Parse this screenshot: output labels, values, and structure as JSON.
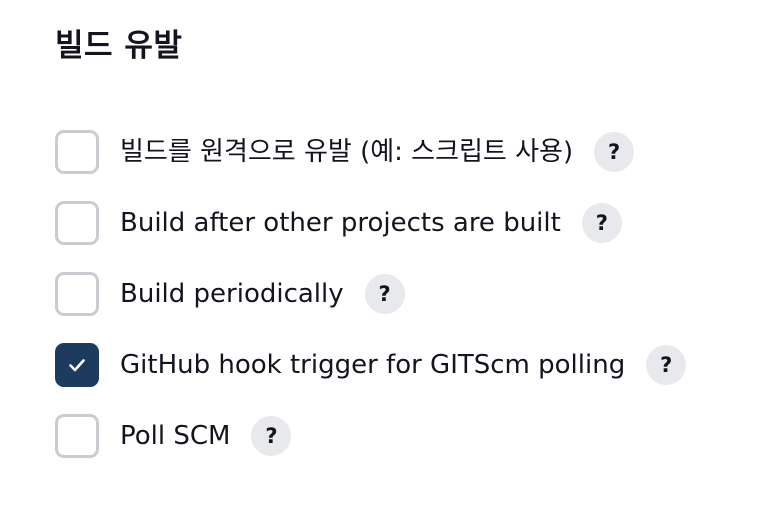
{
  "section": {
    "title": "빌드 유발"
  },
  "options": [
    {
      "label": "빌드를 원격으로 유발 (예: 스크립트 사용)",
      "checked": false,
      "help": "?"
    },
    {
      "label": "Build after other projects are built",
      "checked": false,
      "help": "?"
    },
    {
      "label": "Build periodically",
      "checked": false,
      "help": "?"
    },
    {
      "label": "GitHub hook trigger for GITScm polling",
      "checked": true,
      "help": "?"
    },
    {
      "label": "Poll SCM",
      "checked": false,
      "help": "?"
    }
  ],
  "icons": {
    "checked_box": "check-icon",
    "help": "question-mark"
  },
  "colors": {
    "checked_fill": "#1d3b5c",
    "unchecked_border": "#c9cdd2",
    "help_bg": "#e8e9ec",
    "text": "#14141f"
  }
}
